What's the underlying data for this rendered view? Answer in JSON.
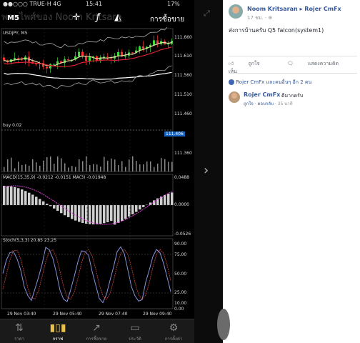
{
  "status": {
    "carrier": "●●○○○ TRUE-H  4G",
    "time": "15:41",
    "battery": "17%"
  },
  "watermark": "พจนไพศ์ของ Noom Kritsara",
  "toolbar": {
    "symbol_label": "M5",
    "action_label": "การซื้อขาย",
    "crosshair_icon": "crosshair-icon",
    "indicator_icon": "function-icon",
    "objects_icon": "shapes-icon"
  },
  "chart": {
    "symbol": "USDJPY, M5",
    "price_labels": [
      "111.660",
      "111.610",
      "111.560",
      "111.510",
      "111.460",
      "111.410",
      "111.360"
    ],
    "current_price": "111.406",
    "buy_label": "buy 0.02",
    "macd_label": "MACD(15,35,9) -0.0212 -0.0151 MA(3) -0.01948",
    "macd_levels": [
      "0.0488",
      "0.0000",
      "-0.0526"
    ],
    "stoch_label": "Stoch(5,3,3) 20.85 23.25",
    "stoch_levels": [
      "90.00",
      "75.00",
      "50.00",
      "25.00",
      "10.00",
      "0.00"
    ],
    "time_labels": [
      "29 Nov 03:40",
      "29 Nov 05:40",
      "29 Nov 07:40",
      "29 Nov 09:40"
    ]
  },
  "tabs": [
    {
      "label": "ราคา",
      "icon": "quotes-icon"
    },
    {
      "label": "กราฟ",
      "icon": "chart-icon"
    },
    {
      "label": "การซื้อขาย",
      "icon": "trade-icon"
    },
    {
      "label": "ประวัติ",
      "icon": "history-icon"
    },
    {
      "label": "การตั้งค่า",
      "icon": "settings-icon"
    }
  ],
  "facebook": {
    "author": "Noom Kritsaran ▸ Rojer CmFx",
    "time": "17 ชม. · ⊕",
    "post": "ส่งการบ้านครับ Q5 falcon(system1)",
    "like_label": "ถูกใจ",
    "comment_label": "แสดงความคิดเห็น",
    "liked_by": "Rojer CmFx และคนอื่นๆ อีก 2 คน",
    "comment": {
      "name": "Rojer CmFx",
      "text": "ดีมากครับ",
      "like": "ถูกใจ",
      "reply": "ตอบกลับ",
      "age": "35 นาที"
    }
  }
}
